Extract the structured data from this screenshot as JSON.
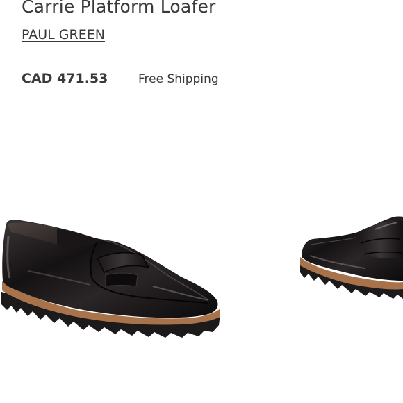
{
  "product": {
    "title": "Carrie Platform Loafer",
    "brand": "PAUL GREEN",
    "price": "CAD 471.53",
    "shipping": "Free Shipping"
  },
  "image": {
    "subject": "black-patent-loafer-pair-icon",
    "colors": {
      "upper": "#141214",
      "sole": "#1c1a1a",
      "welt": "#a8734a",
      "background": "#ffffff"
    }
  }
}
